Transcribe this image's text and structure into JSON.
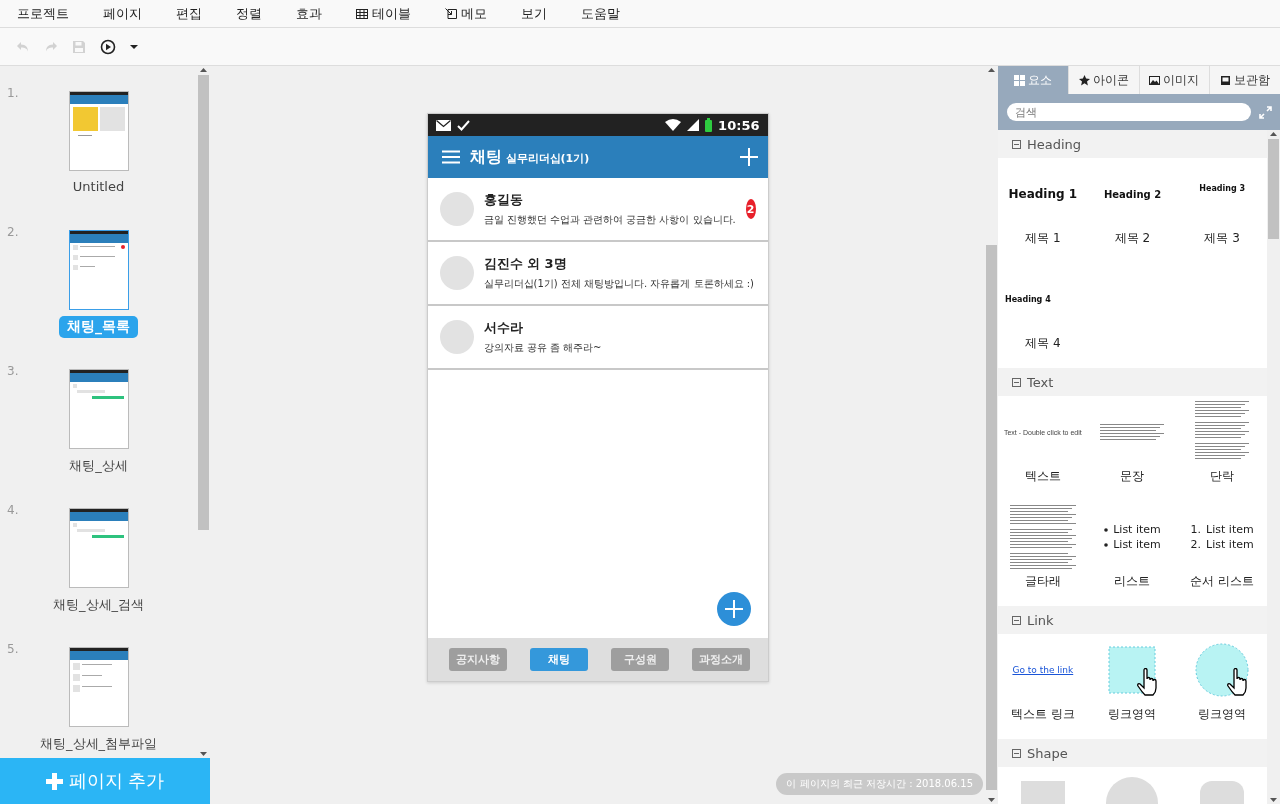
{
  "menu": [
    {
      "label": "프로젝트"
    },
    {
      "label": "페이지"
    },
    {
      "label": "편집"
    },
    {
      "label": "정렬"
    },
    {
      "label": "효과"
    },
    {
      "label": "테이블",
      "kind": "table"
    },
    {
      "label": "메모",
      "kind": "memo"
    },
    {
      "label": "보기"
    },
    {
      "label": "도움말"
    }
  ],
  "toolbar": [
    {
      "kind": "undo",
      "disabled": true
    },
    {
      "kind": "redo",
      "disabled": true
    },
    {
      "kind": "save",
      "disabled": true
    },
    {
      "kind": "play",
      "disabled": false
    },
    {
      "kind": "caret",
      "disabled": false
    }
  ],
  "pages": [
    {
      "number": "1.",
      "title": "Untitled",
      "selected": false,
      "kind": "cover"
    },
    {
      "number": "2.",
      "title": "채팅_목록",
      "selected": true,
      "kind": "list"
    },
    {
      "number": "3.",
      "title": "채팅_상세",
      "selected": false,
      "kind": "chat"
    },
    {
      "number": "4.",
      "title": "채팅_상세_검색",
      "selected": false,
      "kind": "chat"
    },
    {
      "number": "5.",
      "title": "채팅_상세_첨부파일",
      "selected": false,
      "kind": "files"
    }
  ],
  "add_page": {
    "label": "페이지 추가"
  },
  "phone": {
    "time": "10:56",
    "title": "채팅",
    "subtitle": "실무리더십(1기)",
    "chats": [
      {
        "name": "홍길동",
        "message": "금일 진행했던 수업과 관련하여 궁금한 사항이 있습니다.",
        "unread": "2"
      },
      {
        "name": "김진수 외 3명",
        "message": "실무리더십(1기) 전체 채팅방입니다. 자유롭게 토론하세요 :)"
      },
      {
        "name": "서수라",
        "message": "강의자료 공유 좀 해주라~"
      }
    ],
    "tabs": [
      {
        "label": "공지사항",
        "selected": false
      },
      {
        "label": "채팅",
        "selected": true
      },
      {
        "label": "구성원",
        "selected": false
      },
      {
        "label": "과정소개",
        "selected": false
      }
    ]
  },
  "save_notice": "이 페이지의 최근 저장시간 : 2018.06.15",
  "library": {
    "tabs": [
      {
        "label": "요소",
        "kind": "grid",
        "selected": true
      },
      {
        "label": "아이콘",
        "kind": "star",
        "selected": false
      },
      {
        "label": "이미지",
        "kind": "image",
        "selected": false
      },
      {
        "label": "보관함",
        "kind": "inbox",
        "selected": false
      }
    ],
    "search": {
      "placeholder": "검색"
    },
    "sections": [
      {
        "title": "Heading",
        "expanded": true,
        "items": [
          {
            "kind": "heading1",
            "sample": "Heading 1",
            "label": "제목 1"
          },
          {
            "kind": "heading2",
            "sample": "Heading 2",
            "label": "제목 2"
          },
          {
            "kind": "heading3",
            "sample": "Heading 3",
            "label": "제목 3"
          },
          {
            "kind": "heading4",
            "sample": "Heading 4",
            "label": "제목 4"
          }
        ]
      },
      {
        "title": "Text",
        "expanded": true,
        "items": [
          {
            "kind": "text",
            "sample": "Text - Double click to edit",
            "label": "텍스트"
          },
          {
            "kind": "sentence",
            "label": "문장"
          },
          {
            "kind": "paragraph",
            "label": "단락"
          },
          {
            "kind": "essay",
            "label": "글타래"
          },
          {
            "kind": "bullet-list",
            "entries": [
              "List item",
              "List item"
            ],
            "label": "리스트"
          },
          {
            "kind": "ordered-list",
            "entries": [
              {
                "number": "1.",
                "text": "List item"
              },
              {
                "number": "2.",
                "text": "List item"
              }
            ],
            "label": "순서 리스트"
          }
        ]
      },
      {
        "title": "Link",
        "expanded": true,
        "items": [
          {
            "kind": "text-link",
            "sample": "Go to the link",
            "label": "텍스트 링크"
          },
          {
            "kind": "link-rect",
            "label": "링크영역"
          },
          {
            "kind": "link-circle",
            "label": "링크영역"
          }
        ]
      },
      {
        "title": "Shape",
        "expanded": true,
        "items": [
          {
            "kind": "shape-rect"
          },
          {
            "kind": "shape-circle"
          },
          {
            "kind": "shape-rounded"
          }
        ]
      }
    ]
  }
}
